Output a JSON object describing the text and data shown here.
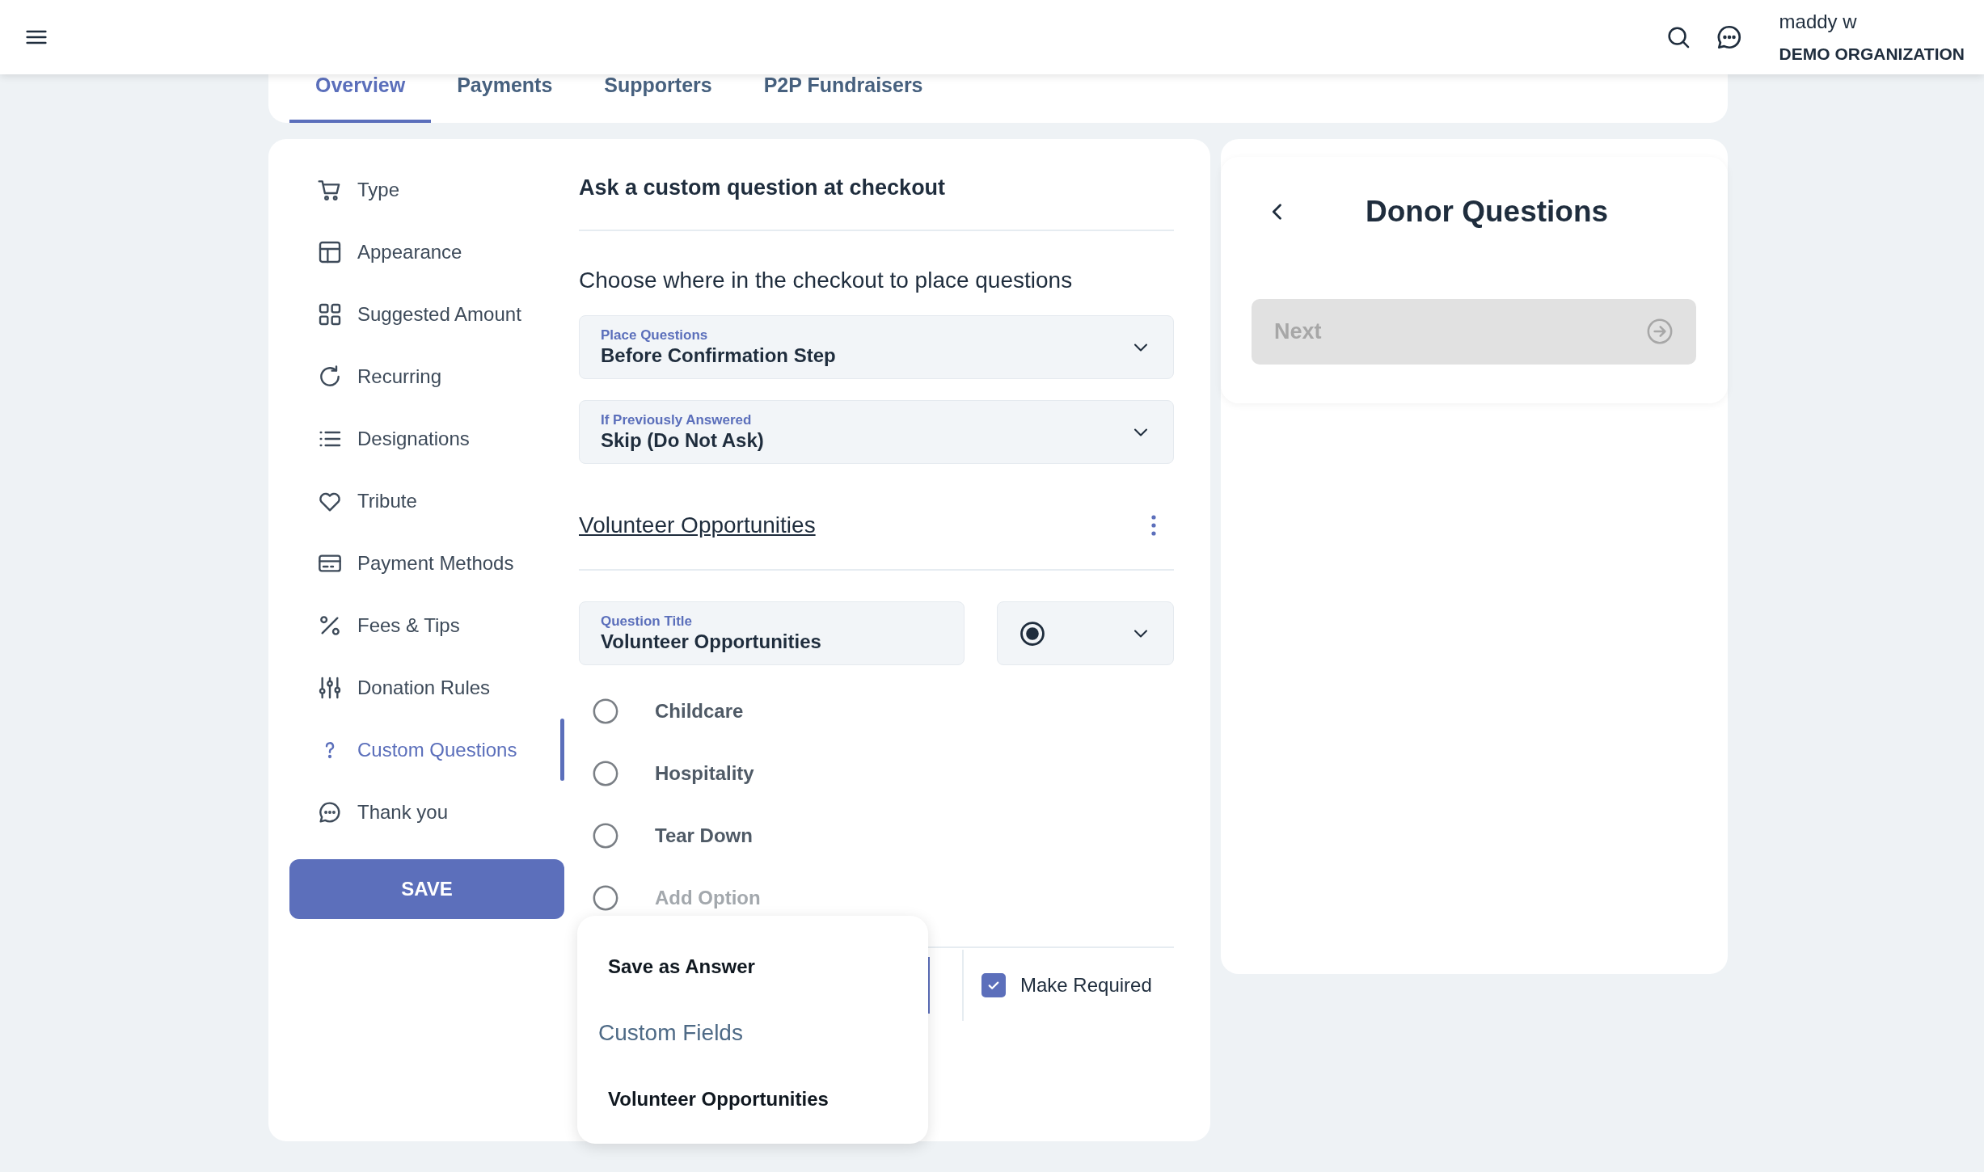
{
  "topbar": {
    "user_name": "maddy w",
    "organization": "DEMO ORGANIZATION"
  },
  "tabs": [
    {
      "label": "Overview",
      "selected": true
    },
    {
      "label": "Payments",
      "selected": false
    },
    {
      "label": "Supporters",
      "selected": false
    },
    {
      "label": "P2P Fundraisers",
      "selected": false
    }
  ],
  "sidebar": {
    "items": [
      {
        "label": "Type",
        "selected": false
      },
      {
        "label": "Appearance",
        "selected": false
      },
      {
        "label": "Suggested Amount",
        "selected": false
      },
      {
        "label": "Recurring",
        "selected": false
      },
      {
        "label": "Designations",
        "selected": false
      },
      {
        "label": "Tribute",
        "selected": false
      },
      {
        "label": "Payment Methods",
        "selected": false
      },
      {
        "label": "Fees & Tips",
        "selected": false
      },
      {
        "label": "Donation Rules",
        "selected": false
      },
      {
        "label": "Custom Questions",
        "selected": true
      },
      {
        "label": "Thank you",
        "selected": false
      }
    ],
    "save_button": "SAVE"
  },
  "section": {
    "title": "Ask a custom question at checkout",
    "instruction": "Choose where in the checkout to place questions",
    "selects": [
      {
        "label": "Place Questions",
        "value": "Before Confirmation Step"
      },
      {
        "label": "If Previously Answered",
        "value": "Skip (Do Not Ask)"
      }
    ],
    "question": {
      "name": "Volunteer Opportunities",
      "title_field": {
        "label": "Question Title",
        "value": "Volunteer Opportunities"
      },
      "options": [
        {
          "label": "Childcare"
        },
        {
          "label": "Hospitality"
        },
        {
          "label": "Tear Down"
        }
      ],
      "add_option": {
        "placeholder": "Add Option"
      },
      "make_required": {
        "label": "Make Required",
        "checked": true
      }
    }
  },
  "answer_menu": {
    "items": [
      {
        "kind": "item",
        "label": "Save as Answer"
      },
      {
        "kind": "header",
        "label": "Custom Fields"
      },
      {
        "kind": "item",
        "label": "Volunteer Opportunities"
      }
    ]
  },
  "preview": {
    "title": "Donor Questions",
    "next_button": {
      "label": "Next",
      "disabled": true
    }
  }
}
